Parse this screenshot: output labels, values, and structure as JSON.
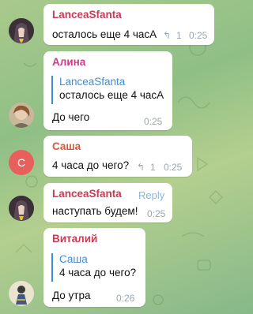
{
  "colors": {
    "lancea": "#cc3a55",
    "alina": "#cc3a88",
    "sasha": "#d65a3a",
    "vitaliy": "#cc3a55",
    "reply_accent": "#3a8fd8",
    "sasha_avatar_bg": "#e8605d"
  },
  "messages": [
    {
      "sender": "LanceaSfanta",
      "text": "осталось еще 4 часА",
      "reply_count": "1",
      "time": "0:25",
      "avatar": "anime-girl-avatar"
    },
    {
      "sender": "Алина",
      "quote_name": "LanceaSfanta",
      "quote_text": "осталось еще 4 часА",
      "text": "До чего",
      "time": "0:25",
      "avatar": "photo-avatar"
    },
    {
      "sender": "Саша",
      "avatar_letter": "С",
      "text": "4 часа до чего?",
      "reply_count": "1",
      "time": "0:25"
    },
    {
      "sender": "LanceaSfanta",
      "reply_label": "Reply",
      "text": "наступать будем!",
      "time": "0:25",
      "avatar": "anime-girl-avatar"
    },
    {
      "sender": "Виталий",
      "quote_name": "Саша",
      "quote_text": "4 часа до чего?",
      "text": "До утра",
      "time": "0:26",
      "avatar": "cartoon-avatar"
    }
  ]
}
